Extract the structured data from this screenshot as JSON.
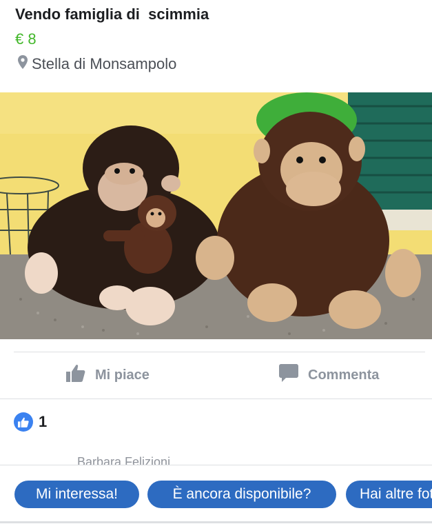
{
  "listing": {
    "title": "Vendo famiglia di  scimmia",
    "price": "€ 8",
    "location": "Stella di Monsampolo"
  },
  "photo": {
    "subject": "plush-monkey-family",
    "colors": {
      "wall": "#f6e27a",
      "ground": "#8f8a82",
      "shutter": "#1f6b5a",
      "leaf": "#3fae3a",
      "dark_fur": "#2c1d16",
      "brown_fur": "#4c2a1a",
      "face": "#d8b48c"
    }
  },
  "actions": [
    {
      "label": "Mi piace",
      "icon": "thumbs-up-icon"
    },
    {
      "label": "Commenta",
      "icon": "comment-icon"
    }
  ],
  "reactions": {
    "icon": "like-reaction-icon",
    "count": "1"
  },
  "comment_preview": {
    "author": "Barbara Felizioni"
  },
  "quick_replies": [
    "Mi interessa!",
    "È ancora disponibile?",
    "Hai altre foto?"
  ],
  "colors": {
    "price": "#42b72a",
    "accent": "#2d6bc1",
    "muted": "#8d949e",
    "like": "#3b82f0"
  }
}
